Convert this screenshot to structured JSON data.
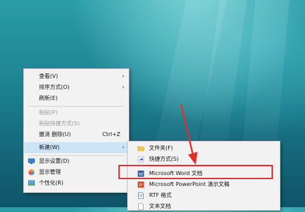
{
  "context_menu": {
    "items": [
      {
        "label": "查看(V)"
      },
      {
        "label": "排序方式(O)"
      },
      {
        "label": "刷新(E)"
      },
      {
        "label": "粘贴(P)"
      },
      {
        "label": "粘贴快捷方式(S)"
      },
      {
        "label": "撤消 删除(U)",
        "shortcut": "Ctrl+Z"
      },
      {
        "label": "新建(W)"
      },
      {
        "label": "显示设置(D)"
      },
      {
        "label": "显示管理"
      },
      {
        "label": "个性化(R)"
      }
    ]
  },
  "new_submenu": {
    "items": [
      {
        "label": "文件夹(F)"
      },
      {
        "label": "快捷方式(S)"
      },
      {
        "label": "Microsoft Word 文档"
      },
      {
        "label": "Microsoft PowerPoint 演示文稿"
      },
      {
        "label": "RTF 格式"
      },
      {
        "label": "文本文档"
      }
    ]
  },
  "annotation": {
    "color": "#e0312d"
  },
  "colors": {
    "highlight": "#cde4f7",
    "menu_bg": "#f2f2f2"
  }
}
